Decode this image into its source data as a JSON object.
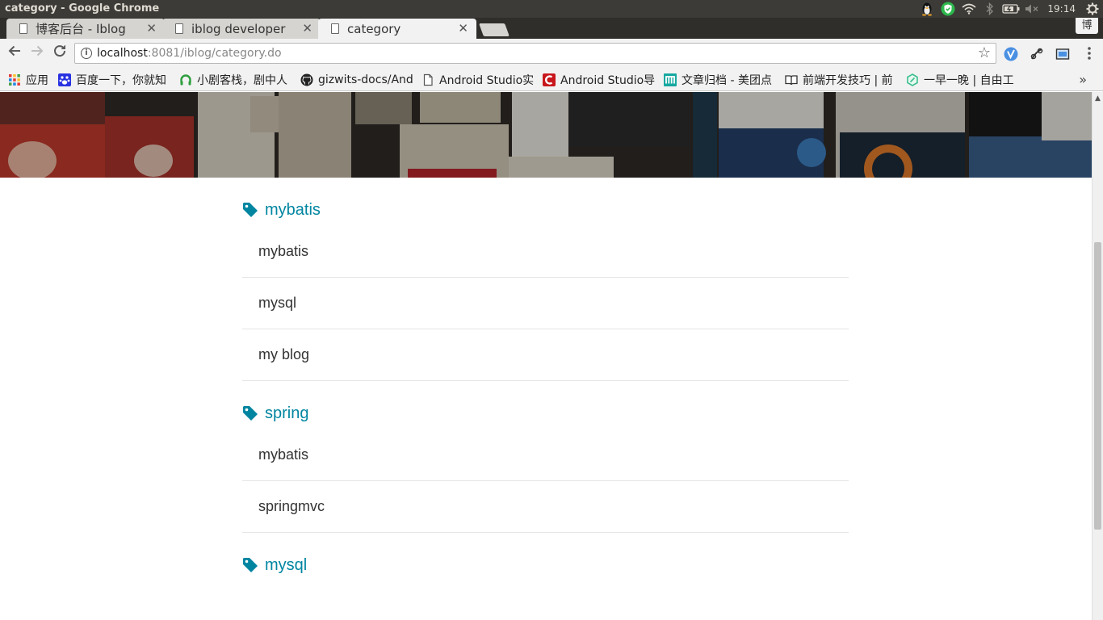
{
  "window": {
    "title": "category - Google Chrome"
  },
  "panel": {
    "clock": "19:14",
    "im_label": "博"
  },
  "tabs": [
    {
      "label": "博客后台 - Iblog",
      "active": false
    },
    {
      "label": "iblog developer",
      "active": false
    },
    {
      "label": "category",
      "active": true
    }
  ],
  "toolbar": {
    "url_host": "localhost",
    "url_rest": ":8081/iblog/category.do",
    "info_glyph": "i"
  },
  "bookmarks": [
    {
      "label": "应用",
      "icon": "apps-grid-icon"
    },
    {
      "label": "百度一下，你就知",
      "icon": "baidu-paw-icon"
    },
    {
      "label": "小剧客栈，剧中人",
      "icon": "headphone-icon"
    },
    {
      "label": "gizwits-docs/And",
      "icon": "github-icon"
    },
    {
      "label": "Android Studio实",
      "icon": "page-icon"
    },
    {
      "label": "Android Studio导",
      "icon": "csdn-icon"
    },
    {
      "label": "文章归档 - 美团点",
      "icon": "meituan-icon"
    },
    {
      "label": "前端开发技巧 | 前",
      "icon": "book-icon"
    },
    {
      "label": "一早一晚 | 自由工",
      "icon": "hexagon-icon"
    }
  ],
  "categories": [
    {
      "name": "mybatis",
      "posts": [
        "mybatis",
        "mysql",
        "my blog"
      ]
    },
    {
      "name": "spring",
      "posts": [
        "mybatis",
        "springmvc"
      ]
    },
    {
      "name": "mysql",
      "posts": []
    }
  ],
  "colors": {
    "accent": "#0085a1",
    "text": "#333333"
  }
}
